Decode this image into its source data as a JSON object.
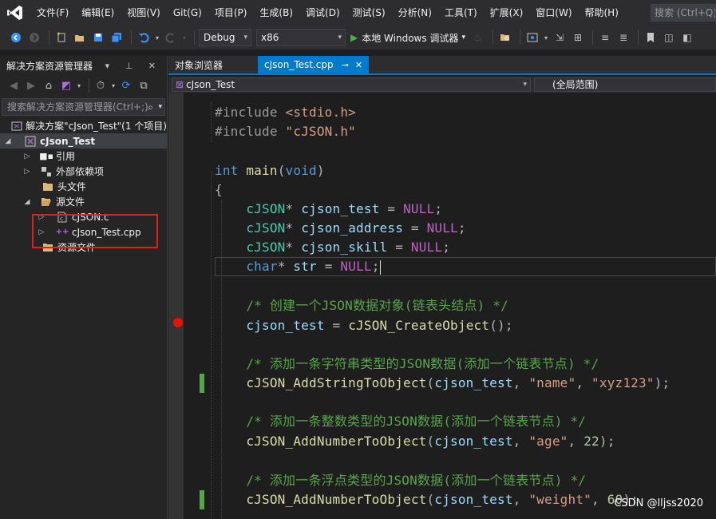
{
  "menu": [
    "文件(F)",
    "编辑(E)",
    "视图(V)",
    "Git(G)",
    "项目(P)",
    "生成(B)",
    "调试(D)",
    "测试(S)",
    "分析(N)",
    "工具(T)",
    "扩展(X)",
    "窗口(W)",
    "帮助(H)"
  ],
  "search": {
    "placeholder": "搜索 (Ctrl+Q)"
  },
  "toolbar": {
    "config": "Debug",
    "platform": "x86",
    "run_label": "本地 Windows 调试器"
  },
  "solution_explorer": {
    "title": "解决方案资源管理器",
    "search_placeholder": "搜索解决方案资源管理器(Ctrl+;)",
    "solution": "解决方案\"cJson_Test\"(1 个项目)",
    "project": "cJson_Test",
    "items": [
      {
        "label": "引用",
        "icon": "references-icon"
      },
      {
        "label": "外部依赖项",
        "icon": "external-deps-icon"
      },
      {
        "label": "头文件",
        "icon": "folder-icon"
      },
      {
        "label": "源文件",
        "icon": "folder-open-icon"
      },
      {
        "label": "cJSON.c",
        "icon": "c-file-icon"
      },
      {
        "label": "cJson_Test.cpp",
        "icon": "cpp-file-icon"
      },
      {
        "label": "资源文件",
        "icon": "folder-icon"
      }
    ]
  },
  "editor": {
    "tabs": [
      "对象浏览器",
      "cJson_Test.cpp"
    ],
    "nav_scope": "cJson_Test",
    "nav_member": "(全局范围)",
    "code": [
      "#include <stdio.h>",
      "#include \"cJSON.h\"",
      "",
      "int main(void)",
      "{",
      "    cJSON* cjson_test = NULL;",
      "    cJSON* cjson_address = NULL;",
      "    cJSON* cjson_skill = NULL;",
      "    char* str = NULL;",
      "",
      "    /* 创建一个JSON数据对象(链表头结点) */",
      "    cjson_test = cJSON_CreateObject();",
      "",
      "    /* 添加一条字符串类型的JSON数据(添加一个链表节点) */",
      "    cJSON_AddStringToObject(cjson_test, \"name\", \"xyz123\");",
      "",
      "    /* 添加一条整数类型的JSON数据(添加一个链表节点) */",
      "    cJSON_AddNumberToObject(cjson_test, \"age\", 22);",
      "",
      "    /* 添加一条浮点类型的JSON数据(添加一个链表节点) */",
      "    cJSON_AddNumberToObject(cjson_test, \"weight\", 60);"
    ]
  },
  "watermark": "CSDN @lljss2020"
}
